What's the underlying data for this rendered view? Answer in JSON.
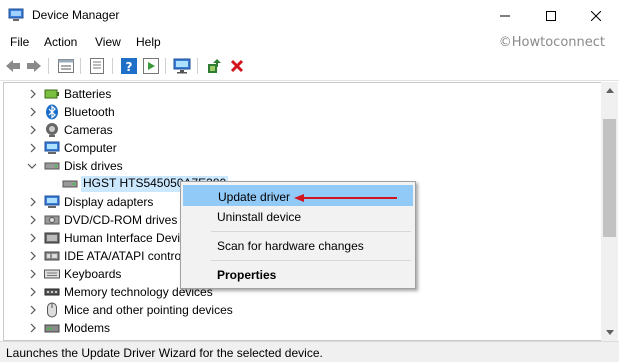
{
  "window": {
    "title": "Device Manager",
    "min_symbol": "—",
    "max_symbol": "☐",
    "close_symbol": "✕"
  },
  "menu": {
    "items": [
      "File",
      "Action",
      "View",
      "Help"
    ],
    "watermark": "©Howtoconnect"
  },
  "toolbar": {
    "buttons": [
      "back-icon",
      "forward-icon",
      "properties-view-icon",
      "show-hide-icon",
      "help-icon",
      "run-icon",
      "monitor-icon",
      "update-driver-icon",
      "uninstall-icon"
    ],
    "uninstall_color": "#d4141c"
  },
  "tree": {
    "items": [
      {
        "label": "Batteries",
        "expanded": false
      },
      {
        "label": "Bluetooth",
        "expanded": false
      },
      {
        "label": "Cameras",
        "expanded": false
      },
      {
        "label": "Computer",
        "expanded": false
      },
      {
        "label": "Disk drives",
        "expanded": true
      },
      {
        "label": "HGST HTS545050A7E380",
        "child": true,
        "selected": true
      },
      {
        "label": "Display adapters",
        "expanded": false
      },
      {
        "label": "DVD/CD-ROM drives",
        "expanded": false
      },
      {
        "label": "Human Interface Devices",
        "expanded": false
      },
      {
        "label": "IDE ATA/ATAPI controllers",
        "expanded": false
      },
      {
        "label": "Keyboards",
        "expanded": false
      },
      {
        "label": "Memory technology devices",
        "expanded": false
      },
      {
        "label": "Mice and other pointing devices",
        "expanded": false
      },
      {
        "label": "Modems",
        "expanded": false
      }
    ]
  },
  "context_menu": {
    "items": [
      {
        "label": "Update driver",
        "highlighted": true
      },
      {
        "label": "Uninstall device"
      },
      {
        "label": "Scan for hardware changes"
      },
      {
        "label": "Properties",
        "bold": true
      }
    ],
    "arrow_color": "#d4141c"
  },
  "status": {
    "text": "Launches the Update Driver Wizard for the selected device."
  },
  "colors": {
    "highlight": "#91c9f7",
    "selection": "#cce8ff",
    "accent_blue": "#1e6fc7"
  }
}
